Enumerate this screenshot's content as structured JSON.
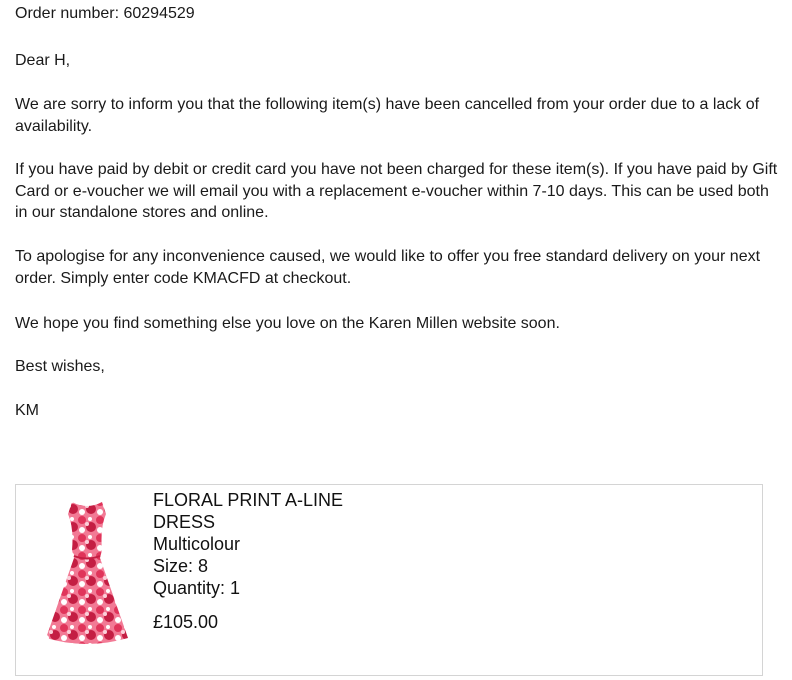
{
  "email": {
    "order_number": "Order number: 60294529",
    "greeting": "Dear H,",
    "paragraph_cancelled": "We are sorry to inform you that the following item(s) have been cancelled from your order due to a lack of availability.",
    "paragraph_payment": "If you have paid by debit or credit card you have not been charged for these item(s). If you have paid by Gift Card or e-voucher we will email you with a replacement e-voucher within 7-10 days. This can be used both in our standalone stores and online.",
    "paragraph_apology": "To apologise for any inconvenience caused, we would like to offer you free standard delivery on your next order. Simply enter code KMACFD at checkout.",
    "paragraph_hope": "We hope you find something else you love on the Karen Millen website soon.",
    "signoff": "Best wishes,",
    "signature": "KM"
  },
  "item": {
    "name_line1": "FLORAL PRINT A-LINE",
    "name_line2": "DRESS",
    "colour": "Multicolour",
    "size": "Size: 8",
    "quantity": "Quantity: 1",
    "price": "£105.00",
    "image_icon": "dress-image",
    "dress_colors": [
      "#e0345a",
      "#f27a95",
      "#ffffff",
      "#c41e43"
    ]
  }
}
